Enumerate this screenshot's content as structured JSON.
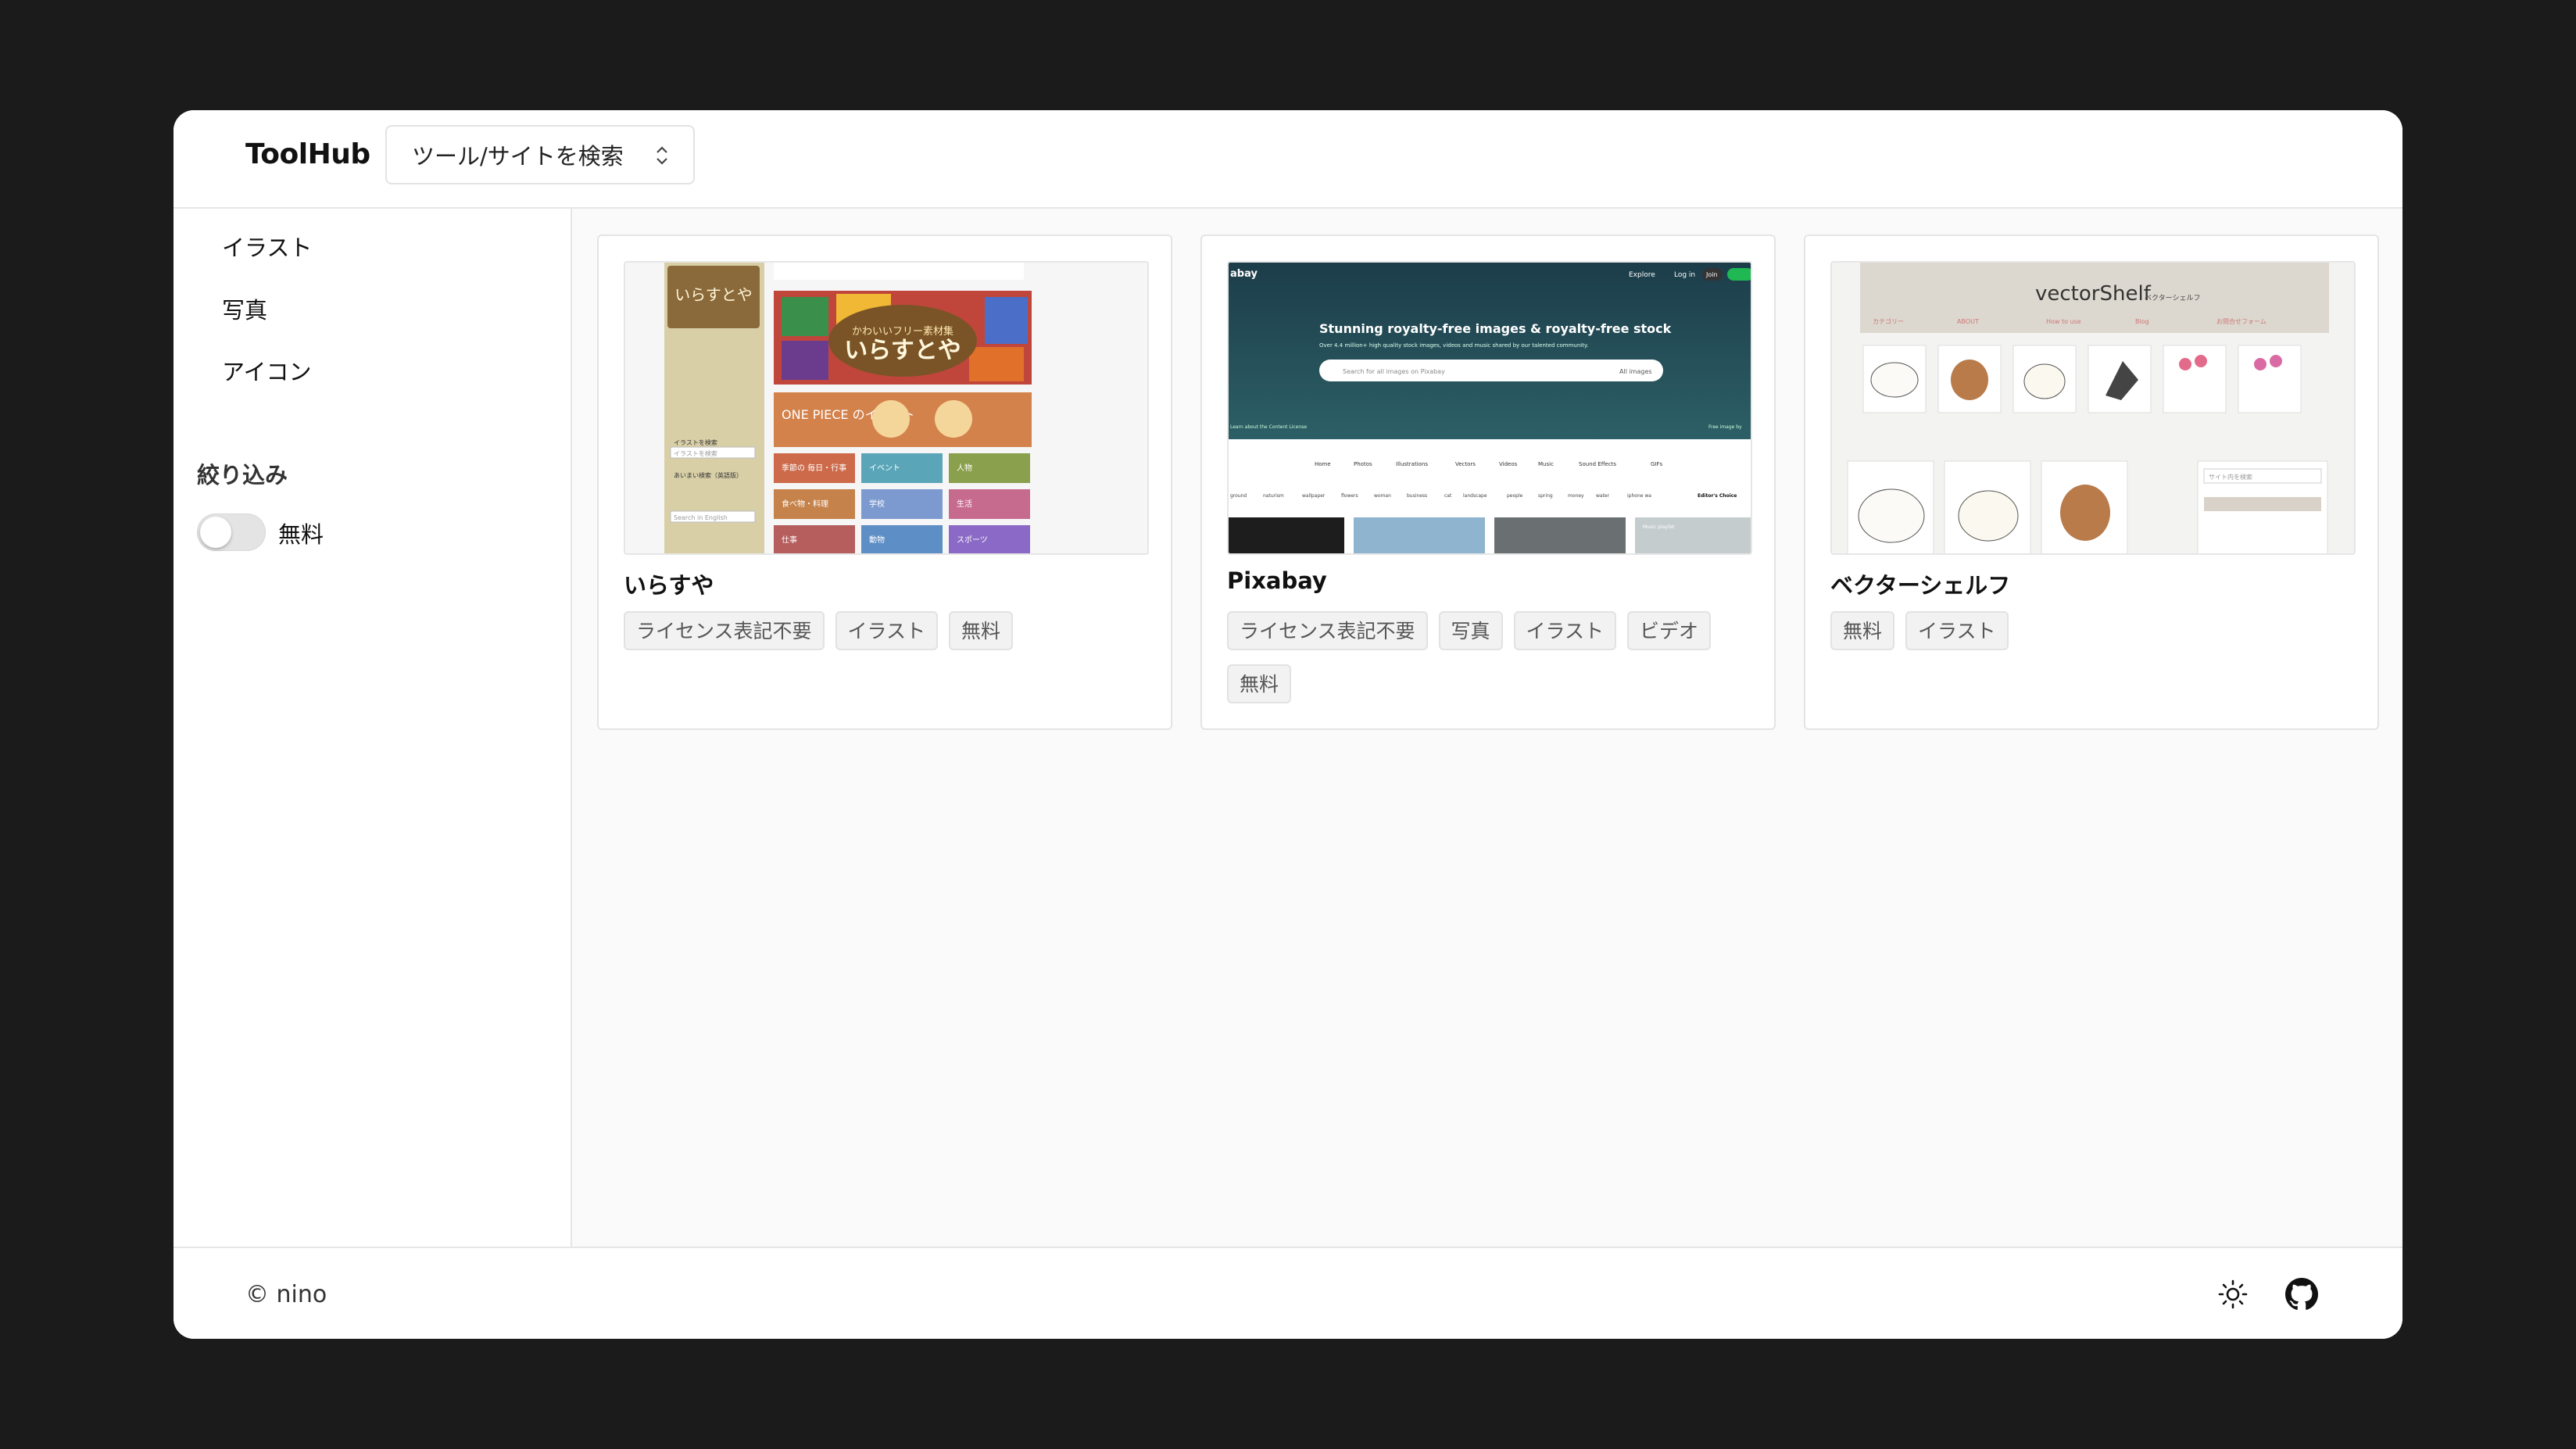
{
  "app": {
    "title": "ToolHub"
  },
  "search": {
    "label": "ツール/サイトを検索"
  },
  "sidebar": {
    "items": [
      {
        "label": "イラスト"
      },
      {
        "label": "写真"
      },
      {
        "label": "アイコン"
      }
    ],
    "filter_title": "絞り込み",
    "filter_toggle_label": "無料",
    "filter_toggle_on": false
  },
  "cards": [
    {
      "title": "いらすや",
      "tags": [
        "ライセンス表記不要",
        "イラスト",
        "無料"
      ],
      "thumbnail": {
        "site_title": "いらすとや",
        "subtitle": "かわいいフリー素材集",
        "banner": "ONE PIECE のイラスト",
        "menu": [
          "季節の 毎日・行事",
          "イベント",
          "人物",
          "食べ物・料理",
          "学校",
          "生活",
          "仕事",
          "動物",
          "スポーツ"
        ],
        "search_label": "イラストを検索",
        "search_placeholder": "イラストを検索",
        "english_label": "あいまい検索（英語版）",
        "english_placeholder": "Search in English"
      }
    },
    {
      "title": "Pixabay",
      "tags": [
        "ライセンス表記不要",
        "写真",
        "イラスト",
        "ビデオ",
        "無料"
      ],
      "thumbnail": {
        "logo": "abay",
        "nav": [
          "Explore",
          "Log in",
          "Join"
        ],
        "headline": "Stunning royalty-free images & royalty-free stock",
        "subline": "Over 4.4 million+ high quality stock images, videos and music shared by our talented community.",
        "search_placeholder": "Search for all images on Pixabay",
        "search_scope": "All images",
        "tabs": [
          "Home",
          "Photos",
          "Illustrations",
          "Vectors",
          "Videos",
          "Music",
          "Sound Effects",
          "GIFs"
        ],
        "keywords": [
          "ground",
          "naturism",
          "wallpaper",
          "flowers",
          "woman",
          "business",
          "cat",
          "landscape",
          "people",
          "spring",
          "money",
          "water",
          "iphone wa"
        ],
        "editors_choice": "Editor's Choice",
        "license_note": "Learn about the Content License",
        "credit": "Free image by",
        "playlist": "Music playlist"
      }
    },
    {
      "title": "ベクターシェルフ",
      "tags": [
        "無料",
        "イラスト"
      ],
      "thumbnail": {
        "site_title": "vectorShelf",
        "site_title_ja": "ベクターシェルフ",
        "nav": [
          "カテゴリー",
          "ABOUT",
          "How to use",
          "Blog",
          "お問合せフォーム"
        ],
        "search_placeholder": "サイト内を検索"
      }
    }
  ],
  "footer": {
    "copyright": "© nino"
  },
  "colors": {
    "backdrop": "#1b1b1b",
    "surface": "#ffffff",
    "main_bg": "#fafafa",
    "border": "#e6e6e6",
    "tag_bg": "#f2f2f2"
  }
}
